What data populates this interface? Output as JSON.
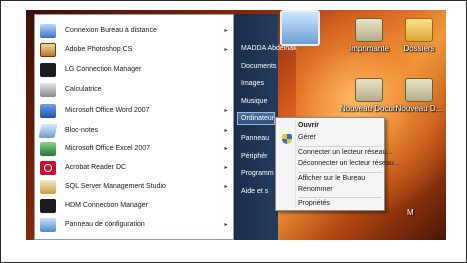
{
  "start_menu": {
    "programs": [
      {
        "label": "Connexion Bureau à distance",
        "icon": "remote-desktop-icon",
        "arrow": "▸"
      },
      {
        "label": "Adobe Photoshop CS",
        "icon": "photoshop-icon",
        "arrow": "▸"
      },
      {
        "label": "LG Connection Manager",
        "icon": "lg-icon",
        "arrow": ""
      },
      {
        "label": "Calculatrice",
        "icon": "calculator-icon",
        "arrow": ""
      },
      {
        "label": "Microsoft Office Word 2007",
        "icon": "word-icon",
        "arrow": "▸"
      },
      {
        "label": "Bloc-notes",
        "icon": "notepad-icon",
        "arrow": "▸"
      },
      {
        "label": "Microsoft Office Excel 2007",
        "icon": "excel-icon",
        "arrow": "▸"
      },
      {
        "label": "Acrobat Reader DC",
        "icon": "acrobat-icon",
        "arrow": "▸"
      },
      {
        "label": "SQL Server Management Studio",
        "icon": "sql-server-icon",
        "arrow": "▸"
      },
      {
        "label": "HDM Connection Manager",
        "icon": "hdm-icon",
        "arrow": ""
      },
      {
        "label": "Panneau de configuration",
        "icon": "control-panel-icon",
        "arrow": "▸"
      }
    ],
    "right_items": [
      {
        "label": "MADDA Abdelhak"
      },
      {
        "label": "Documents"
      },
      {
        "label": "Images"
      },
      {
        "label": "Musique"
      },
      {
        "label": "Ordinateur",
        "selected": true
      },
      {
        "label": "Panneau"
      },
      {
        "label": "Périphér"
      },
      {
        "label": "Programm"
      },
      {
        "label": "Aide et s"
      }
    ]
  },
  "context_menu": {
    "items": [
      {
        "label": "Ouvrir",
        "bold": true
      },
      {
        "label": "Gérer"
      },
      {
        "label": "Connecter un lecteur réseau..."
      },
      {
        "label": "Déconnecter un lecteur réseau..."
      },
      {
        "label": "Afficher sur le Bureau"
      },
      {
        "label": "Renommer"
      },
      {
        "label": "Propriétés"
      }
    ]
  },
  "desktop": {
    "icons": [
      {
        "label": "Imprimante"
      },
      {
        "label": "Dossiers"
      },
      {
        "label": "Nouveau Document Mi..."
      },
      {
        "label": "Nouveau D..."
      }
    ],
    "edge_letter": "M"
  },
  "colors": {
    "taskbar_blue": "#233c5e",
    "desktop_orange": "#d2581a",
    "menu_border": "#8aa0b8"
  }
}
